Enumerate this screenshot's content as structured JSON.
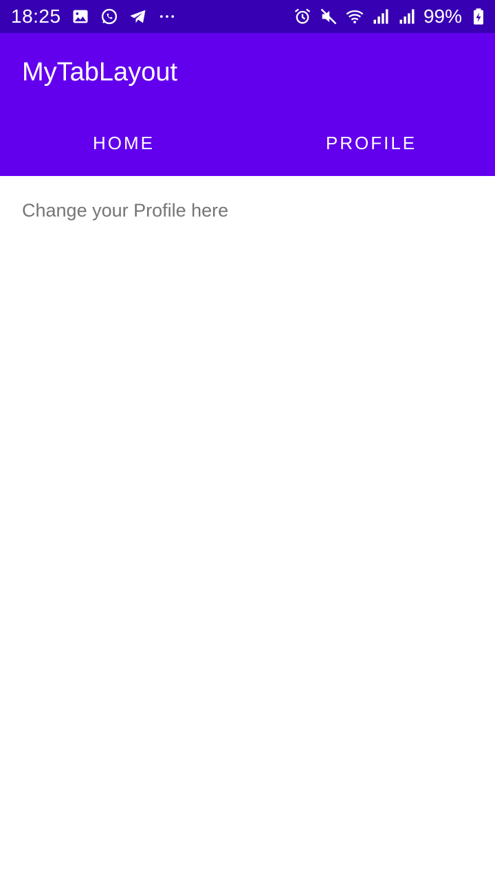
{
  "status_bar": {
    "time": "18:25",
    "battery": "99%",
    "left_icons": [
      "image-icon",
      "whatsapp-icon",
      "telegram-icon",
      "more-notifications-icon"
    ],
    "right_icons": [
      "alarm-icon",
      "mute-icon",
      "wifi-icon",
      "signal-icon",
      "signal-icon-2",
      "battery-charging-icon"
    ]
  },
  "app_bar": {
    "title": "MyTabLayout",
    "color": "#6200ee"
  },
  "status_bar_color": "#3700b3",
  "tabs": [
    {
      "label": "HOME"
    },
    {
      "label": "PROFILE"
    }
  ],
  "content": {
    "text": "Change your Profile here"
  }
}
